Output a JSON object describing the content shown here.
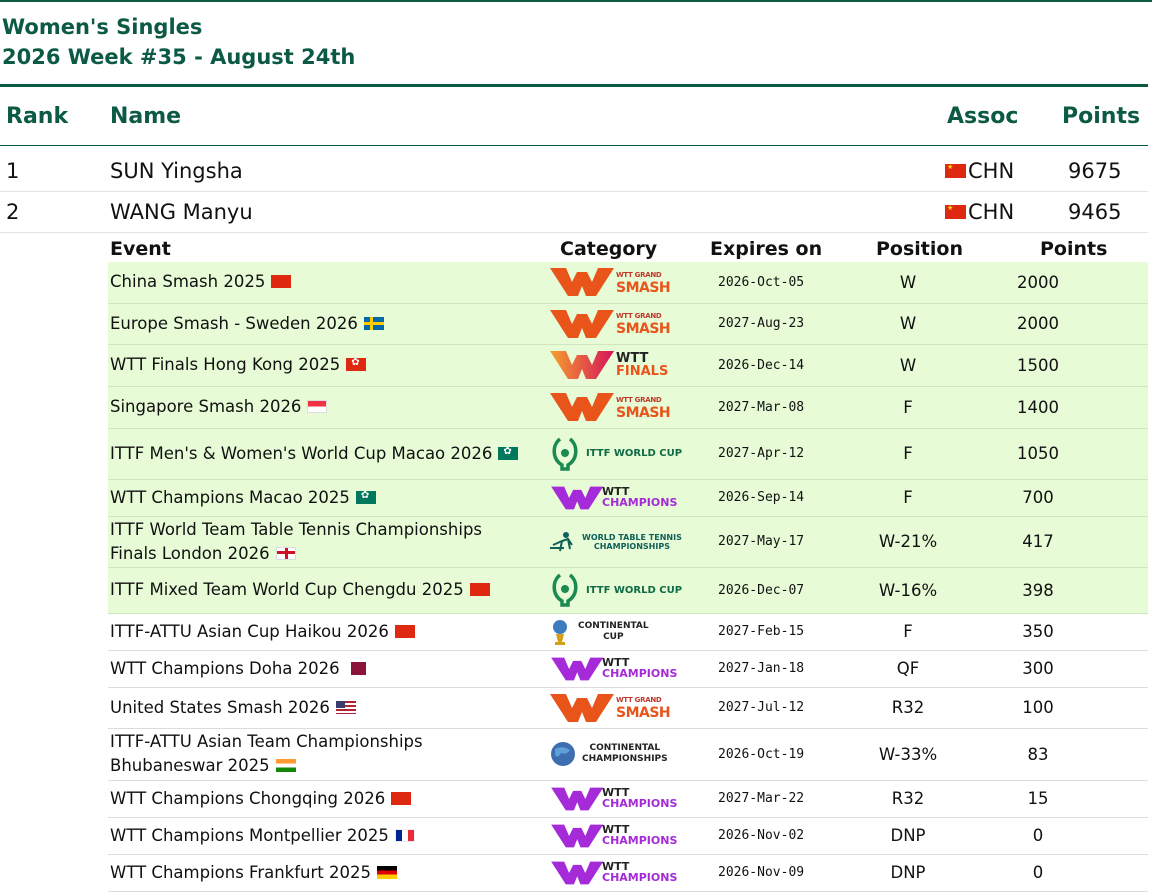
{
  "header": {
    "title_line1": "Women's Singles",
    "title_line2": "2026 Week #35 - August 24th"
  },
  "columns": {
    "rank": "Rank",
    "name": "Name",
    "assoc": "Assoc",
    "points": "Points"
  },
  "players": [
    {
      "rank": "1",
      "name": "SUN Yingsha",
      "assoc": "CHN",
      "points": "9675"
    },
    {
      "rank": "2",
      "name": "WANG Manyu",
      "assoc": "CHN",
      "points": "9465"
    }
  ],
  "events_header": {
    "event": "Event",
    "category": "Category",
    "expires": "Expires on",
    "position": "Position",
    "points": "Points"
  },
  "events": [
    {
      "name": "China Smash 2025",
      "flag": "cn",
      "category": "smash",
      "cat_a": "WTT GRAND",
      "cat_b": "SMASH",
      "expires": "2026-Oct-05",
      "position": "W",
      "points": "2000",
      "highlight": true
    },
    {
      "name": "Europe Smash - Sweden 2026",
      "flag": "se",
      "category": "smash",
      "cat_a": "WTT GRAND",
      "cat_b": "SMASH",
      "expires": "2027-Aug-23",
      "position": "W",
      "points": "2000",
      "highlight": true
    },
    {
      "name": "WTT Finals Hong Kong 2025",
      "flag": "hk",
      "category": "finals",
      "cat_a": "WTT",
      "cat_b": "FINALS",
      "expires": "2026-Dec-14",
      "position": "W",
      "points": "1500",
      "highlight": true
    },
    {
      "name": "Singapore Smash 2026",
      "flag": "sg",
      "category": "smash",
      "cat_a": "WTT GRAND",
      "cat_b": "SMASH",
      "expires": "2027-Mar-08",
      "position": "F",
      "points": "1400",
      "highlight": true
    },
    {
      "name": "ITTF Men's & Women's World Cup Macao 2026",
      "flag": "mo",
      "category": "worldcup",
      "cat_a": "ITTF WORLD CUP",
      "cat_b": "",
      "expires": "2027-Apr-12",
      "position": "F",
      "points": "1050",
      "highlight": true
    },
    {
      "name": "WTT Champions Macao 2025",
      "flag": "mo",
      "category": "champions",
      "cat_a": "WTT",
      "cat_b": "CHAMPIONS",
      "expires": "2026-Sep-14",
      "position": "F",
      "points": "700",
      "highlight": true
    },
    {
      "name": "ITTF World Team Table Tennis Championships Finals London 2026",
      "flag": "en",
      "category": "wttc",
      "cat_a": "WORLD TABLE TENNIS",
      "cat_b": "CHAMPIONSHIPS",
      "expires": "2027-May-17",
      "position": "W-21%",
      "points": "417",
      "highlight": true
    },
    {
      "name": "ITTF Mixed Team World Cup Chengdu 2025",
      "flag": "cn",
      "category": "worldcup",
      "cat_a": "ITTF WORLD CUP",
      "cat_b": "",
      "expires": "2026-Dec-07",
      "position": "W-16%",
      "points": "398",
      "highlight": true
    },
    {
      "name": "ITTF-ATTU Asian Cup Haikou 2026",
      "flag": "cn",
      "category": "continental",
      "cat_a": "CONTINENTAL",
      "cat_b": "CUP",
      "expires": "2027-Feb-15",
      "position": "F",
      "points": "350",
      "highlight": false
    },
    {
      "name": "WTT Champions Doha 2026",
      "flag": "qa",
      "category": "champions",
      "cat_a": "WTT",
      "cat_b": "CHAMPIONS",
      "expires": "2027-Jan-18",
      "position": "QF",
      "points": "300",
      "highlight": false
    },
    {
      "name": "United States Smash 2026",
      "flag": "us",
      "category": "smash",
      "cat_a": "WTT GRAND",
      "cat_b": "SMASH",
      "expires": "2027-Jul-12",
      "position": "R32",
      "points": "100",
      "highlight": false
    },
    {
      "name": "ITTF-ATTU Asian Team Championships Bhubaneswar 2025",
      "flag": "in",
      "category": "continental2",
      "cat_a": "CONTINENTAL",
      "cat_b": "CHAMPIONSHIPS",
      "expires": "2026-Oct-19",
      "position": "W-33%",
      "points": "83",
      "highlight": false
    },
    {
      "name": "WTT Champions Chongqing 2026",
      "flag": "cn",
      "category": "champions",
      "cat_a": "WTT",
      "cat_b": "CHAMPIONS",
      "expires": "2027-Mar-22",
      "position": "R32",
      "points": "15",
      "highlight": false
    },
    {
      "name": "WTT Champions Montpellier 2025",
      "flag": "fr",
      "category": "champions",
      "cat_a": "WTT",
      "cat_b": "CHAMPIONS",
      "expires": "2026-Nov-02",
      "position": "DNP",
      "points": "0",
      "highlight": false
    },
    {
      "name": "WTT Champions Frankfurt 2025",
      "flag": "de",
      "category": "champions",
      "cat_a": "WTT",
      "cat_b": "CHAMPIONS",
      "expires": "2026-Nov-09",
      "position": "DNP",
      "points": "0",
      "highlight": false
    }
  ],
  "colors": {
    "brand_green": "#0c5a44",
    "highlight_row": "#e6fbd6",
    "smash_orange": "#e8541a",
    "champions_purple": "#a52ad8"
  }
}
